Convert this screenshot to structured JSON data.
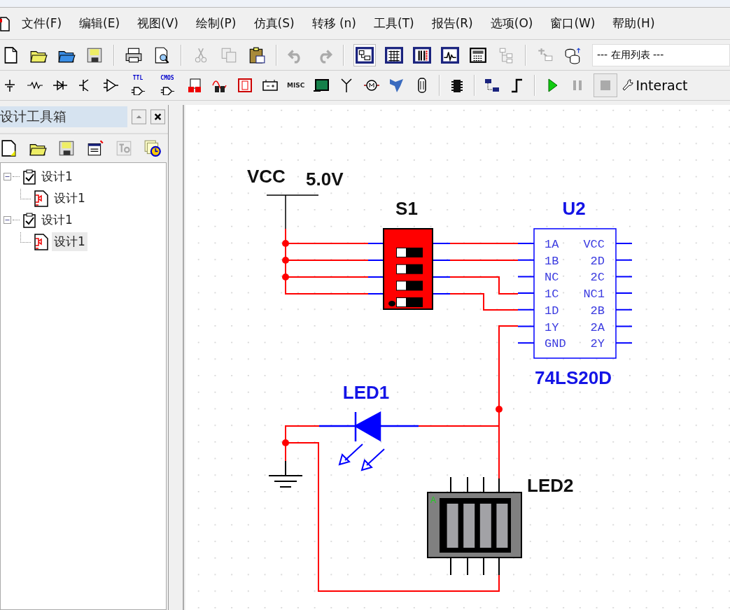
{
  "menu": [
    "文件(F)",
    "编辑(E)",
    "视图(V)",
    "绘制(P)",
    "仿真(S)",
    "转移 (n)",
    "工具(T)",
    "报告(R)",
    "选项(O)",
    "窗口(W)",
    "帮助(H)"
  ],
  "toolbar": {
    "list_value": "--- 在用列表 ---",
    "ttl_label": "TTL",
    "cmos_label": "CMOS",
    "misc_label": "MISC",
    "interactive_label": "Interact"
  },
  "design_toolbox": {
    "title": "设计工具箱",
    "tree": [
      {
        "label": "设计1",
        "selected": false,
        "expanded": true,
        "children": [
          {
            "label": "设计1",
            "selected": false
          }
        ]
      },
      {
        "label": "设计1",
        "selected": false,
        "expanded": true,
        "children": [
          {
            "label": "设计1",
            "selected": true
          }
        ]
      }
    ]
  },
  "schematic": {
    "vcc": {
      "name": "VCC",
      "voltage": "5.0V"
    },
    "switch": {
      "name": "S1",
      "positions": [
        {
          "on": false
        },
        {
          "on": false
        },
        {
          "on": false
        },
        {
          "on": false
        }
      ]
    },
    "chip": {
      "name": "U2",
      "part": "74LS20D",
      "pins_left": [
        "1A",
        "1B",
        "NC",
        "1C",
        "1D",
        "1Y",
        "GND"
      ],
      "pins_right": [
        "VCC",
        "2D",
        "2C",
        "NC1",
        "2B",
        "2A",
        "2Y"
      ]
    },
    "led": {
      "name": "LED1"
    },
    "bargraph": {
      "name": "LED2",
      "pin_mark": "A"
    }
  }
}
